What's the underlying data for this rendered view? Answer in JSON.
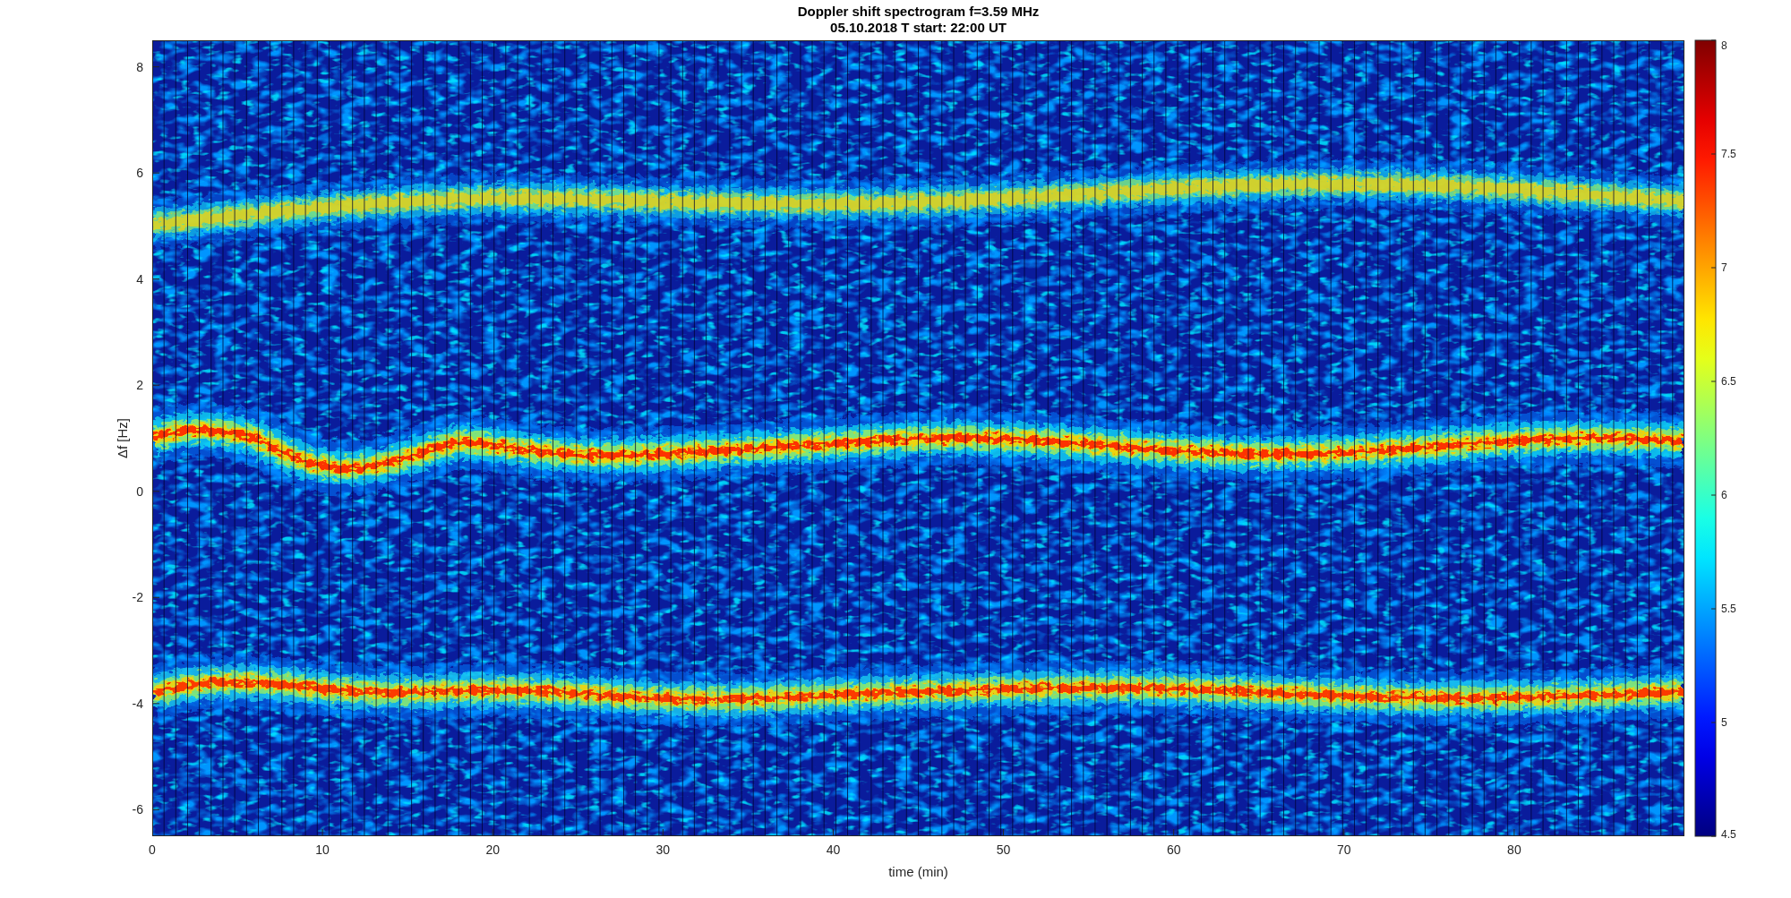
{
  "figure": {
    "title_lines": [
      "Doppler shift spectrogram f=3.59 MHz",
      "05.10.2018   T start: 22:00 UT"
    ],
    "xlabel": "time (min)",
    "ylabel": "Δf [Hz]",
    "xticks": [
      "0",
      "10",
      "20",
      "30",
      "40",
      "50",
      "60",
      "70",
      "80"
    ],
    "yticks": [
      "8",
      "6",
      "4",
      "2",
      "0",
      "-2",
      "-4",
      "-6"
    ],
    "colorbar": {
      "ticks": [
        "8",
        "7.5",
        "7",
        "6.5",
        "6",
        "5.5",
        "5",
        "4.5"
      ]
    }
  }
}
